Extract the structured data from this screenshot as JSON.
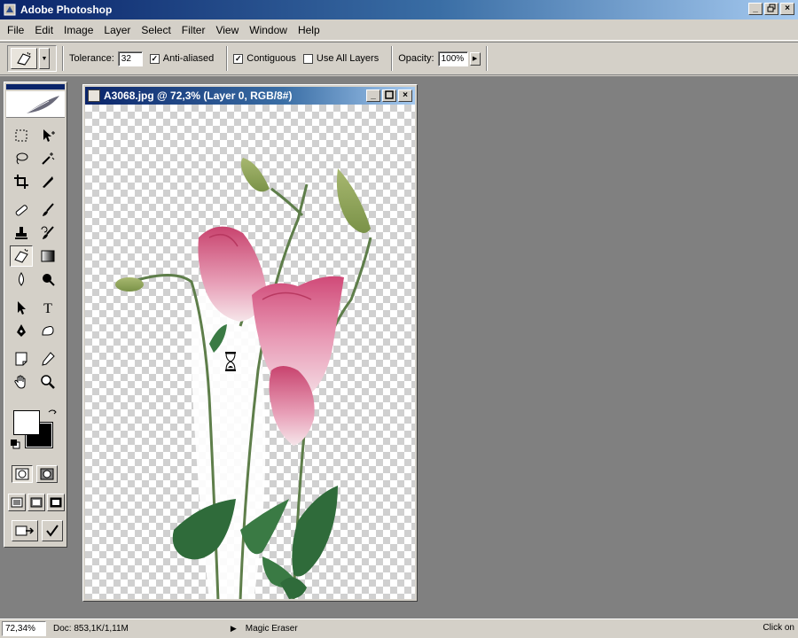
{
  "app": {
    "title": "Adobe Photoshop"
  },
  "window_buttons": {
    "minimize": "_",
    "maximize": "ɑ",
    "close": "×"
  },
  "menu": [
    "File",
    "Edit",
    "Image",
    "Layer",
    "Select",
    "Filter",
    "View",
    "Window",
    "Help"
  ],
  "options": {
    "tolerance_label": "Tolerance:",
    "tolerance_value": "32",
    "anti_aliased_label": "Anti-aliased",
    "anti_aliased_checked": true,
    "contiguous_label": "Contiguous",
    "contiguous_checked": true,
    "use_all_layers_label": "Use All Layers",
    "use_all_layers_checked": false,
    "opacity_label": "Opacity:",
    "opacity_value": "100%"
  },
  "document": {
    "title": "A3068.jpg @ 72,3% (Layer 0, RGB/8#)"
  },
  "toolbox": {
    "active_tool": "magic-eraser",
    "foreground_color": "#ffffff",
    "background_color": "#000000"
  },
  "statusbar": {
    "zoom": "72,34%",
    "doc_info": "Doc: 853,1K/1,11M",
    "current_tool": "Magic Eraser",
    "hint": "Click on"
  },
  "colors": {
    "title_gradient_start": "#0a246a",
    "workspace_bg": "#808080",
    "flower_pink": "#c8436e",
    "leaf_green": "#2f6b3a"
  }
}
